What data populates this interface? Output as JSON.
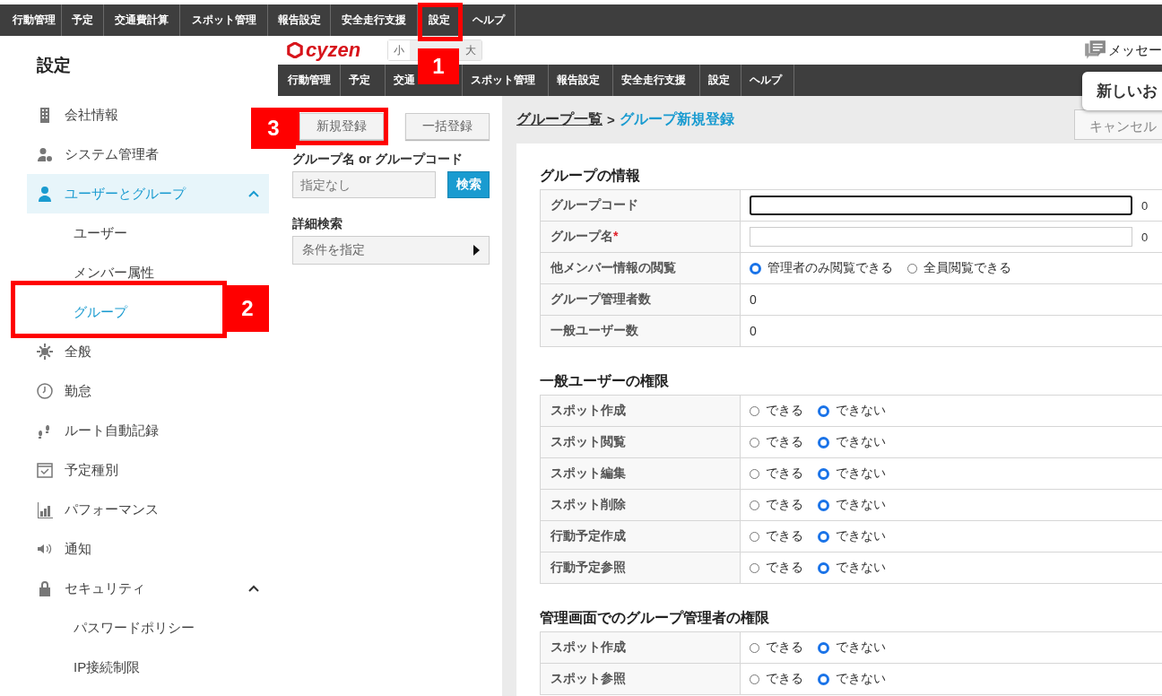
{
  "top_nav": [
    "行動管理",
    "予定",
    "交通費計算",
    "スポット管理",
    "報告設定",
    "安全走行支援",
    "設定",
    "ヘルプ"
  ],
  "sidebar": {
    "title": "設定",
    "items": [
      {
        "label": "会社情報",
        "selected": false
      },
      {
        "label": "システム管理者",
        "selected": false
      },
      {
        "label": "ユーザーとグループ",
        "selected": true,
        "expanded": true,
        "children": [
          {
            "label": "ユーザー",
            "selected": false
          },
          {
            "label": "メンバー属性",
            "selected": false
          },
          {
            "label": "グループ",
            "selected": true
          }
        ]
      },
      {
        "label": "全般",
        "selected": false
      },
      {
        "label": "勤怠",
        "selected": false
      },
      {
        "label": "ルート自動記録",
        "selected": false
      },
      {
        "label": "予定種別",
        "selected": false
      },
      {
        "label": "パフォーマンス",
        "selected": false
      },
      {
        "label": "通知",
        "selected": false
      },
      {
        "label": "セキュリティ",
        "selected": false,
        "expanded": true,
        "children": [
          {
            "label": "パスワードポリシー",
            "selected": false
          },
          {
            "label": "IP接続制限",
            "selected": false
          }
        ]
      }
    ]
  },
  "app": {
    "logo": "cyzen",
    "font_sizes": [
      "小",
      "大"
    ],
    "messages": "メッセー",
    "nav": [
      "行動管理",
      "予定",
      "交通",
      "スポット管理",
      "報告設定",
      "安全走行支援",
      "設定",
      "ヘルプ"
    ],
    "notice": "新しいお"
  },
  "list_panel": {
    "buttons": [
      "新規登録",
      "一括登録"
    ],
    "search": {
      "label": "グループ名 or グループコード",
      "placeholder": "指定なし",
      "button": "検索"
    },
    "advanced": {
      "label": "詳細検索",
      "dropdown": "条件を指定"
    }
  },
  "form": {
    "breadcrumb": {
      "link": "グループ一覧",
      "separator": ">",
      "current": "グループ新規登録"
    },
    "cancel": "キャンセル",
    "sections": [
      {
        "title": "グループの情報",
        "rows": [
          {
            "kind": "input",
            "label": "グループコード",
            "focused": true,
            "counter": "0"
          },
          {
            "kind": "input",
            "label": "グループ名",
            "mark": "*",
            "focused": false,
            "counter": "0"
          },
          {
            "kind": "radio",
            "label": "他メンバー情報の閲覧",
            "options": [
              {
                "label": "管理者のみ閲覧できる",
                "selected": true
              },
              {
                "label": "全員閲覧できる",
                "selected": false
              }
            ]
          },
          {
            "kind": "value",
            "label": "グループ管理者数",
            "value": "0"
          },
          {
            "kind": "value",
            "label": "一般ユーザー数",
            "value": "0"
          }
        ]
      },
      {
        "title": "一般ユーザーの権限",
        "rows": [
          {
            "kind": "radio",
            "label": "スポット作成",
            "options": [
              {
                "label": "できる",
                "selected": false
              },
              {
                "label": "できない",
                "selected": true
              }
            ]
          },
          {
            "kind": "radio",
            "label": "スポット閲覧",
            "options": [
              {
                "label": "できる",
                "selected": false
              },
              {
                "label": "できない",
                "selected": true
              }
            ]
          },
          {
            "kind": "radio",
            "label": "スポット編集",
            "options": [
              {
                "label": "できる",
                "selected": false
              },
              {
                "label": "できない",
                "selected": true
              }
            ]
          },
          {
            "kind": "radio",
            "label": "スポット削除",
            "options": [
              {
                "label": "できる",
                "selected": false
              },
              {
                "label": "できない",
                "selected": true
              }
            ]
          },
          {
            "kind": "radio",
            "label": "行動予定作成",
            "options": [
              {
                "label": "できる",
                "selected": false
              },
              {
                "label": "できない",
                "selected": true
              }
            ]
          },
          {
            "kind": "radio",
            "label": "行動予定参照",
            "options": [
              {
                "label": "できる",
                "selected": false
              },
              {
                "label": "できない",
                "selected": true
              }
            ]
          }
        ]
      },
      {
        "title": "管理画面でのグループ管理者の権限",
        "rows": [
          {
            "kind": "radio",
            "label": "スポット作成",
            "options": [
              {
                "label": "できる",
                "selected": false
              },
              {
                "label": "できない",
                "selected": true
              }
            ]
          },
          {
            "kind": "radio",
            "label": "スポット参照",
            "options": [
              {
                "label": "できる",
                "selected": false
              },
              {
                "label": "できない",
                "selected": true
              }
            ]
          }
        ]
      }
    ]
  },
  "annotations": [
    {
      "number": "1"
    },
    {
      "number": "2"
    },
    {
      "number": "3"
    }
  ]
}
